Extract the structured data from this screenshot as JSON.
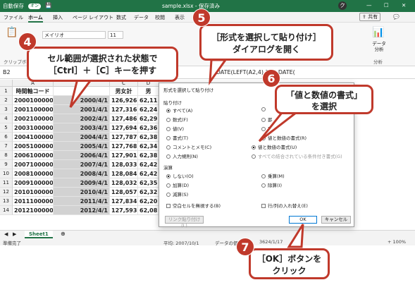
{
  "titlebar": {
    "autosave_label": "自動保存",
    "autosave_state": "オン",
    "file_title": "sample.xlsx - 保存済み",
    "user_initials": "ク"
  },
  "ribbon_tabs": [
    "ファイル",
    "ホーム",
    "挿入",
    "ページ レイアウト",
    "数式",
    "データ",
    "校閲",
    "表示"
  ],
  "ribbon": {
    "share_label": "共有",
    "font_name": "メイリオ",
    "font_size": "11",
    "clipboard_group": "クリップボ",
    "data_analysis_label": "データ分析",
    "analysis_group": "分析"
  },
  "formula_bar": {
    "name_box": "B2",
    "formula": "=DATE(LEFT(A2,4),1,1),DATE("
  },
  "columns": {
    "A": "A",
    "C": "C",
    "D": "D"
  },
  "header_row": {
    "row_num": "1",
    "a": "時間軸コード",
    "b": "",
    "c": "男女計",
    "d": "男"
  },
  "rows": [
    {
      "n": "2",
      "a": "2000100000",
      "b": "2000/4/1",
      "c": "126,926",
      "d": "62,11"
    },
    {
      "n": "3",
      "a": "2001100000",
      "b": "2001/4/1",
      "c": "127,316",
      "d": "62,24"
    },
    {
      "n": "4",
      "a": "2002100000",
      "b": "2002/4/1",
      "c": "127,486",
      "d": "62,29"
    },
    {
      "n": "5",
      "a": "2003100000",
      "b": "2003/4/1",
      "c": "127,694",
      "d": "62,36"
    },
    {
      "n": "6",
      "a": "2004100000",
      "b": "2004/4/1",
      "c": "127,787",
      "d": "62,38"
    },
    {
      "n": "7",
      "a": "2005100000",
      "b": "2005/4/1",
      "c": "127,768",
      "d": "62,34"
    },
    {
      "n": "8",
      "a": "2006100000",
      "b": "2006/4/1",
      "c": "127,901",
      "d": "62,38"
    },
    {
      "n": "9",
      "a": "2007100000",
      "b": "2007/4/1",
      "c": "128,033",
      "d": "62,42"
    },
    {
      "n": "10",
      "a": "2008100000",
      "b": "2008/4/1",
      "c": "128,084",
      "d": "62,42"
    },
    {
      "n": "11",
      "a": "2009100000",
      "b": "2009/4/1",
      "c": "128,032",
      "d": "62,35"
    },
    {
      "n": "12",
      "a": "2010100000",
      "b": "2010/4/1",
      "c": "128,057",
      "d": "62,32"
    },
    {
      "n": "13",
      "a": "2011100000",
      "b": "2011/4/1",
      "c": "127,834",
      "d": "62,20"
    },
    {
      "n": "14",
      "a": "2012100000",
      "b": "2012/4/1",
      "c": "127,593",
      "d": "62,08"
    }
  ],
  "sheet_tab": "Sheet1",
  "status": {
    "ready": "準備完了",
    "average": "平均: 2007/10/1",
    "count": "データの個数: 1",
    "sum": "3624/1/17",
    "zoom": "+ 100%"
  },
  "dialog": {
    "title": "形式を選択して貼り付け",
    "paste_group": "貼り付け",
    "paste_left": [
      "すべて(A)",
      "数式(F)",
      "値(V)",
      "書式(T)",
      "コメントとメモ(C)",
      "入力規則(N)"
    ],
    "paste_right": [
      "",
      "",
      "",
      "値と数値の書式(R)",
      "値と数値の書式(U)",
      "すべての結合されている条件付き書式(G)"
    ],
    "paste_right_partial": [
      "罫",
      "列",
      "数式と数値の書式(R)"
    ],
    "op_group": "演算",
    "op_left": [
      "しない(O)",
      "加算(D)",
      "減算(S)"
    ],
    "op_right": [
      "乗算(M)",
      "除算(I)"
    ],
    "skip_blanks": "空白セルを無視する(B)",
    "transpose": "行/列の入れ替え(E)",
    "paste_link": "リンク貼り付け(L)",
    "ok": "OK",
    "cancel": "キャンセル"
  },
  "callouts": {
    "c4_num": "4",
    "c4_text1": "セル範囲が選択された状態で",
    "c4_text2": "［Ctrl］＋［C］キーを押す",
    "c5_num": "5",
    "c5_text1": "［形式を選択して貼り付け］",
    "c5_text2": "ダイアログを開く",
    "c6_num": "6",
    "c6_text1": "「値と数値の書式」",
    "c6_text2": "を選択",
    "c7_num": "7",
    "c7_text1": "［OK］ボタンを",
    "c7_text2": "クリック"
  },
  "colors": {
    "excel_green": "#217346",
    "callout_red": "#c0392b"
  }
}
